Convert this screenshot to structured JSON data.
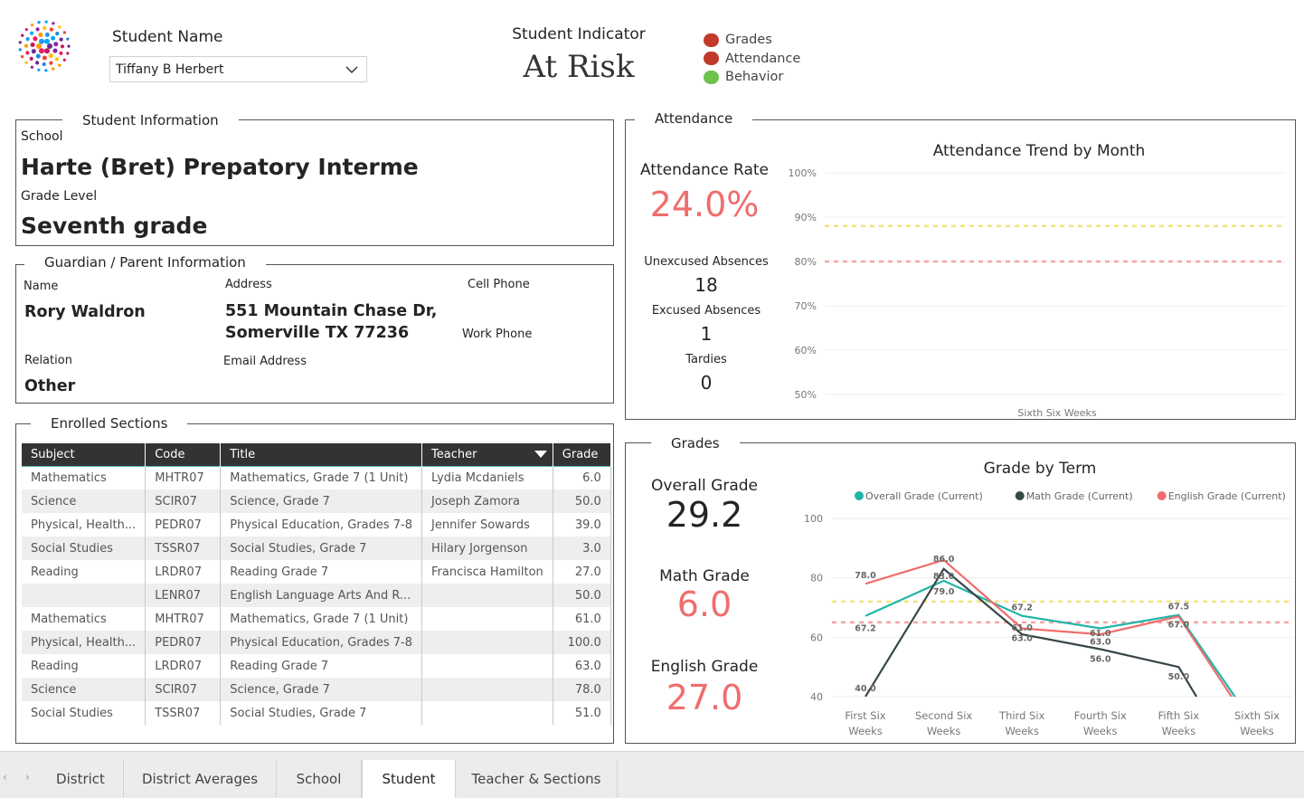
{
  "header": {
    "student_name_label": "Student Name",
    "student_select_value": "Tiffany B Herbert",
    "indicator_label": "Student Indicator",
    "indicator_value": "At Risk",
    "legend": [
      {
        "label": "Grades",
        "color": "#c0392b"
      },
      {
        "label": "Attendance",
        "color": "#c0392b"
      },
      {
        "label": "Behavior",
        "color": "#6cc24a"
      }
    ]
  },
  "student_info": {
    "title": "Student Information",
    "school_label": "School",
    "school_value": "Harte (Bret) Prepatory Interme",
    "grade_level_label": "Grade Level",
    "grade_level_value": "Seventh grade"
  },
  "guardian": {
    "title": "Guardian / Parent Information",
    "name_label": "Name",
    "name_value": "Rory Waldron",
    "address_label": "Address",
    "address_line1": "551 Mountain Chase Dr,",
    "address_line2": "Somerville TX 77236",
    "cell_label": "Cell Phone",
    "work_label": "Work Phone",
    "relation_label": "Relation",
    "relation_value": "Other",
    "email_label": "Email Address"
  },
  "sections": {
    "title": "Enrolled Sections",
    "columns": [
      "Subject",
      "Code",
      "Title",
      "Teacher",
      "Grade"
    ],
    "rows": [
      [
        "Mathematics",
        "MHTR07",
        "Mathematics, Grade 7 (1 Unit)",
        "Lydia Mcdaniels",
        "6.0"
      ],
      [
        "Science",
        "SCIR07",
        "Science, Grade 7",
        "Joseph Zamora",
        "50.0"
      ],
      [
        "Physical, Health...",
        "PEDR07",
        "Physical Education, Grades 7-8",
        "Jennifer Sowards",
        "39.0"
      ],
      [
        "Social Studies",
        "TSSR07",
        "Social Studies, Grade 7",
        "Hilary Jorgenson",
        "3.0"
      ],
      [
        "Reading",
        "LRDR07",
        "Reading Grade 7",
        "Francisca Hamilton",
        "27.0"
      ],
      [
        "",
        "LENR07",
        "English Language Arts And R...",
        "",
        "50.0"
      ],
      [
        "Mathematics",
        "MHTR07",
        "Mathematics, Grade 7 (1 Unit)",
        "",
        "61.0"
      ],
      [
        "Physical, Health...",
        "PEDR07",
        "Physical Education, Grades 7-8",
        "",
        "100.0"
      ],
      [
        "Reading",
        "LRDR07",
        "Reading Grade 7",
        "",
        "63.0"
      ],
      [
        "Science",
        "SCIR07",
        "Science, Grade 7",
        "",
        "78.0"
      ],
      [
        "Social Studies",
        "TSSR07",
        "Social Studies, Grade 7",
        "",
        "51.0"
      ]
    ]
  },
  "attendance": {
    "title": "Attendance",
    "rate_label": "Attendance Rate",
    "rate_value": "24.0%",
    "unexcused_label": "Unexcused Absences",
    "unexcused_value": "18",
    "excused_label": "Excused Absences",
    "excused_value": "1",
    "tardies_label": "Tardies",
    "tardies_value": "0"
  },
  "grades": {
    "title": "Grades",
    "overall_label": "Overall Grade",
    "overall_value": "29.2",
    "math_label": "Math Grade",
    "math_value": "6.0",
    "english_label": "English Grade",
    "english_value": "27.0"
  },
  "chart_data": [
    {
      "type": "line",
      "title": "Attendance Trend by Month",
      "categories": [
        "Sixth Six Weeks"
      ],
      "y_ticks": [
        "100%",
        "90%",
        "80%",
        "70%",
        "60%",
        "50%"
      ],
      "ylim": [
        50,
        100
      ],
      "series": [],
      "reference_lines": [
        {
          "value": 88,
          "color": "#f5e27a"
        },
        {
          "value": 80,
          "color": "#f5a5a5"
        }
      ]
    },
    {
      "type": "line",
      "title": "Grade by Term",
      "categories": [
        "First Six Weeks",
        "Second Six Weeks",
        "Third Six Weeks",
        "Fourth Six Weeks",
        "Fifth Six Weeks",
        "Sixth Six Weeks"
      ],
      "ylim": [
        40,
        100
      ],
      "y_ticks": [
        100,
        80,
        60,
        40
      ],
      "legend_position": "top",
      "series": [
        {
          "name": "Overall Grade (Current)",
          "color": "#1fb5a6",
          "values": [
            67.2,
            79.0,
            67.2,
            63.0,
            67.5,
            29.2
          ]
        },
        {
          "name": "Math Grade (Current)",
          "color": "#374649",
          "values": [
            40.0,
            83.0,
            61.0,
            56.0,
            50.0,
            6.0
          ]
        },
        {
          "name": "English Grade (Current)",
          "color": "#f06d6d",
          "values": [
            78.0,
            86.0,
            63.0,
            61.0,
            67.0,
            27.0
          ]
        }
      ],
      "data_labels": [
        {
          "text": "78.0",
          "series": 2,
          "i": 0
        },
        {
          "text": "67.2",
          "series": 0,
          "i": 0
        },
        {
          "text": "40.0",
          "series": 1,
          "i": 0
        },
        {
          "text": "86.0",
          "series": 2,
          "i": 1
        },
        {
          "text": "83.0",
          "series": 1,
          "i": 1
        },
        {
          "text": "79.0",
          "series": 0,
          "i": 1
        },
        {
          "text": "67.2",
          "series": 0,
          "i": 2
        },
        {
          "text": "61.0",
          "series": 1,
          "i": 2
        },
        {
          "text": "63.0",
          "series": 2,
          "i": 2
        },
        {
          "text": "61.0",
          "series": 2,
          "i": 3
        },
        {
          "text": "63.0",
          "series": 0,
          "i": 3
        },
        {
          "text": "56.0",
          "series": 1,
          "i": 3
        },
        {
          "text": "67.5",
          "series": 0,
          "i": 4
        },
        {
          "text": "67.0",
          "series": 2,
          "i": 4
        },
        {
          "text": "50.0",
          "series": 1,
          "i": 4
        }
      ],
      "reference_lines": [
        {
          "value": 72,
          "color": "#f5e27a"
        },
        {
          "value": 65,
          "color": "#f5a5a5"
        }
      ]
    }
  ],
  "tabs": [
    "District",
    "District Averages",
    "School",
    "Student",
    "Teacher & Sections"
  ],
  "active_tab": "Student"
}
